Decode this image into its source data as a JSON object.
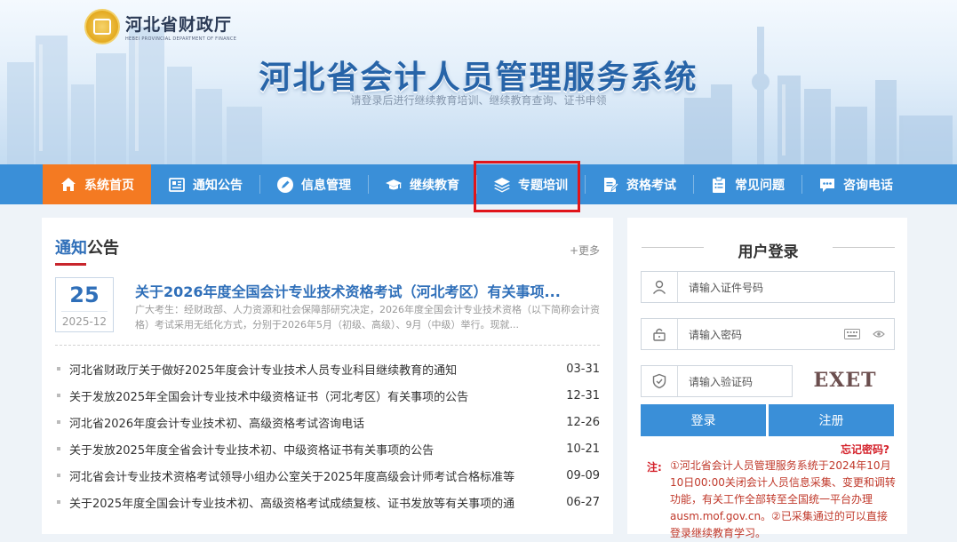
{
  "header": {
    "logo_cn": "河北省财政厅",
    "logo_en": "HEBEI PROVINCIAL DEPARTMENT OF FINANCE",
    "title": "河北省会计人员管理服务系统",
    "subtitle": "请登录后进行继续教育培训、继续教育查询、证书申领"
  },
  "nav": {
    "items": [
      {
        "label": "系统首页",
        "icon": "home-icon"
      },
      {
        "label": "通知公告",
        "icon": "news-icon"
      },
      {
        "label": "信息管理",
        "icon": "edit-icon"
      },
      {
        "label": "继续教育",
        "icon": "graduation-cap-icon"
      },
      {
        "label": "专题培训",
        "icon": "layers-icon"
      },
      {
        "label": "资格考试",
        "icon": "exam-icon"
      },
      {
        "label": "常见问题",
        "icon": "clipboard-icon"
      },
      {
        "label": "咨询电话",
        "icon": "chat-icon"
      }
    ]
  },
  "notice": {
    "title_highlight": "通知",
    "title_rest": "公告",
    "more": "+更多",
    "featured": {
      "day": "25",
      "year_month": "2025-12",
      "title": "关于2026年度全国会计专业技术资格考试（河北考区）有关事项...",
      "desc": "广大考生：经财政部、人力资源和社会保障部研究决定，2026年度全国会计专业技术资格（以下简称会计资格）考试采用无纸化方式，分别于2026年5月（初级、高级）、9月（中级）举行。现就..."
    },
    "items": [
      {
        "text": "河北省财政厅关于做好2025年度会计专业技术人员专业科目继续教育的通知",
        "date": "03-31"
      },
      {
        "text": "关于发放2025年全国会计专业技术中级资格证书（河北考区）有关事项的公告",
        "date": "12-31"
      },
      {
        "text": "河北省2026年度会计专业技术初、高级资格考试咨询电话",
        "date": "12-26"
      },
      {
        "text": "关于发放2025年度全省会计专业技术初、中级资格证书有关事项的公告",
        "date": "10-21"
      },
      {
        "text": "河北省会计专业技术资格考试领导小组办公室关于2025年度高级会计师考试合格标准等",
        "date": "09-09"
      },
      {
        "text": "关于2025年度全国会计专业技术初、高级资格考试成绩复核、证书发放等有关事项的通",
        "date": "06-27"
      }
    ]
  },
  "login": {
    "title": "用户登录",
    "id_placeholder": "请输入证件号码",
    "password_placeholder": "请输入密码",
    "captcha_placeholder": "请输入验证码",
    "captcha_text": "EXET",
    "login_label": "登录",
    "register_label": "注册",
    "forgot_label": "忘记密码?",
    "note_label": "注:",
    "note_text": "①河北省会计人员管理服务系统于2024年10月10日00:00关闭会计人员信息采集、变更和调转功能，有关工作全部转至全国统一平台办理ausm.mof.gov.cn。②已采集通过的可以直接登录继续教育学习。"
  },
  "colors": {
    "nav_bg": "#3a8fd8",
    "nav_active": "#f47a22",
    "title_blue": "#2764a8",
    "link_blue": "#2f6fb9",
    "alert_red": "#d4212a",
    "highlight_red": "#e0151b"
  }
}
